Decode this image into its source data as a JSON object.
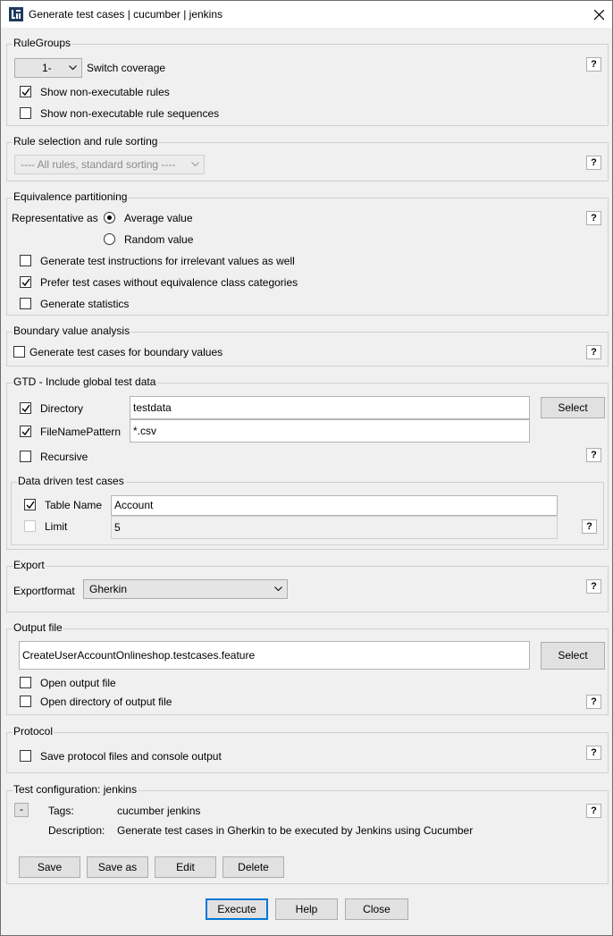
{
  "window": {
    "title": "Generate test cases | cucumber | jenkins"
  },
  "rule_groups": {
    "title": "RuleGroups",
    "coverage_value": "1-",
    "coverage_label": "Switch coverage",
    "show_non_exec_rules": {
      "label": "Show non-executable rules",
      "checked": true
    },
    "show_non_exec_sequences": {
      "label": "Show non-executable rule sequences",
      "checked": false
    }
  },
  "rule_selection": {
    "title": "Rule selection and rule sorting",
    "value": "---- All rules, standard sorting ----"
  },
  "equivalence": {
    "title": "Equivalence partitioning",
    "representative_label": "Representative as",
    "average_label": "Average value",
    "random_label": "Random value",
    "irrelevant": {
      "label": "Generate test instructions for irrelevant values as well",
      "checked": false
    },
    "prefer": {
      "label": "Prefer test cases without equivalence class categories",
      "checked": true
    },
    "statistics": {
      "label": "Generate statistics",
      "checked": false
    }
  },
  "boundary": {
    "title": "Boundary value analysis",
    "generate": {
      "label": "Generate test cases for boundary values",
      "checked": false
    }
  },
  "gtd": {
    "title": "GTD - Include global test data",
    "directory": {
      "label": "Directory",
      "checked": true,
      "value": "testdata"
    },
    "filename_pattern": {
      "label": "FileNamePattern",
      "checked": true,
      "value": "*.csv"
    },
    "recursive": {
      "label": "Recursive",
      "checked": false
    },
    "select_label": "Select",
    "data_driven": {
      "title": "Data driven test cases",
      "table_name": {
        "label": "Table Name",
        "checked": true,
        "value": "Account"
      },
      "limit": {
        "label": "Limit",
        "checked": false,
        "value": "5"
      }
    }
  },
  "export": {
    "title": "Export",
    "format_label": "Exportformat",
    "format_value": "Gherkin"
  },
  "output_file": {
    "title": "Output file",
    "value": "CreateUserAccountOnlineshop.testcases.feature",
    "select_label": "Select",
    "open_output": {
      "label": "Open output file",
      "checked": false
    },
    "open_directory": {
      "label": "Open directory of output file",
      "checked": false
    }
  },
  "protocol": {
    "title": "Protocol",
    "save": {
      "label": "Save protocol files and console output",
      "checked": false
    }
  },
  "test_configuration": {
    "title": "Test configuration: jenkins",
    "collapse_label": "-",
    "tags_label": "Tags:",
    "tags_value": "cucumber jenkins",
    "description_label": "Description:",
    "description_value": "Generate test cases in Gherkin to be executed by Jenkins using Cucumber",
    "save_label": "Save",
    "save_as_label": "Save as",
    "edit_label": "Edit",
    "delete_label": "Delete"
  },
  "footer": {
    "execute_label": "Execute",
    "help_label": "Help",
    "close_label": "Close"
  },
  "help_label": "?",
  "colors": {
    "accent": "#0078d7",
    "window_bg": "#f0f0f0",
    "app_icon": "#1e3a5f"
  }
}
